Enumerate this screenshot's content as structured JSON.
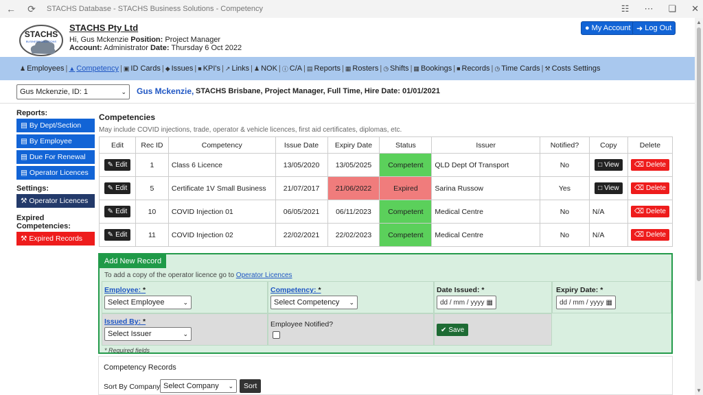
{
  "window": {
    "title": "STACHS Database - STACHS Business Solutions - Competency"
  },
  "header": {
    "logo_text": "STACHS",
    "logo_sub": "BUSINESS SOLUTIONS",
    "company": "STACHS Pty Ltd",
    "hi_prefix": "Hi, Gus Mckenzie",
    "position_label": "Position:",
    "position_value": "Project Manager",
    "account_label": "Account:",
    "account_value": "Administrator",
    "date_label": "Date:",
    "date_value": "Thursday 6 Oct 2022",
    "my_account": "My Account",
    "log_out": "Log Out"
  },
  "nav": [
    {
      "label": "Employees",
      "icon": "users-icon",
      "glyph": "♟"
    },
    {
      "label": "Competency",
      "icon": "graduation-cap-icon",
      "glyph": "▲",
      "active": true
    },
    {
      "label": "ID Cards",
      "icon": "id-card-icon",
      "glyph": "▣"
    },
    {
      "label": "Issues",
      "icon": "tag-icon",
      "glyph": "◆"
    },
    {
      "label": "KPI's",
      "icon": "briefcase-icon",
      "glyph": "■"
    },
    {
      "label": "Links",
      "icon": "external-link-icon",
      "glyph": "↗"
    },
    {
      "label": "NOK",
      "icon": "user-icon",
      "glyph": "♟"
    },
    {
      "label": "C/A",
      "icon": "info-icon",
      "glyph": "ⓘ"
    },
    {
      "label": "Reports",
      "icon": "folder-open-icon",
      "glyph": "▤"
    },
    {
      "label": "Rosters",
      "icon": "calendar-icon",
      "glyph": "▦"
    },
    {
      "label": "Shifts",
      "icon": "clock-icon",
      "glyph": "◷"
    },
    {
      "label": "Bookings",
      "icon": "calendar-check-icon",
      "glyph": "▦"
    },
    {
      "label": "Records",
      "icon": "folder-icon",
      "glyph": "■"
    },
    {
      "label": "Time Cards",
      "icon": "clock-icon",
      "glyph": "◷"
    },
    {
      "label": "Costs Settings",
      "icon": "wrench-icon",
      "glyph": "⚒"
    }
  ],
  "employee_bar": {
    "select_value": "Gus Mckenzie, ID: 1",
    "name": "Gus Mckenzie,",
    "info": "STACHS Brisbane, Project Manager, Full Time, Hire Date: 01/01/2021"
  },
  "sidebar": {
    "reports_heading": "Reports:",
    "reports": [
      "By Dept/Section",
      "By Employee",
      "Due For Renewal",
      "Operator Licences"
    ],
    "settings_heading": "Settings:",
    "settings": [
      "Operator Licences"
    ],
    "expired_heading": "Expired Competencies:",
    "expired": [
      "Expired Records"
    ]
  },
  "main": {
    "title": "Competencies",
    "subtitle": "May include COVID injections, trade, operator & vehicle licences, first aid certificates, diplomas, etc.",
    "columns": [
      "Edit",
      "Rec ID",
      "Competency",
      "Issue Date",
      "Expiry Date",
      "Status",
      "Issuer",
      "Notified?",
      "Copy",
      "Delete"
    ],
    "edit_label": "Edit",
    "view_label": "View",
    "delete_label": "Delete",
    "rows": [
      {
        "rec_id": "1",
        "competency": "Class 6 Licence",
        "issue": "13/05/2020",
        "expiry": "13/05/2025",
        "status": "Competent",
        "issuer": "QLD Dept Of Transport",
        "notified": "No",
        "copy": "View",
        "expired": false
      },
      {
        "rec_id": "5",
        "competency": "Certificate 1V Small Business",
        "issue": "21/07/2017",
        "expiry": "21/06/2022",
        "status": "Expired",
        "issuer": "Sarina Russow",
        "notified": "Yes",
        "copy": "View",
        "expired": true
      },
      {
        "rec_id": "10",
        "competency": "COVID Injection 01",
        "issue": "06/05/2021",
        "expiry": "06/11/2023",
        "status": "Competent",
        "issuer": "Medical Centre",
        "notified": "No",
        "copy": "N/A",
        "expired": false
      },
      {
        "rec_id": "11",
        "competency": "COVID Injection 02",
        "issue": "22/02/2021",
        "expiry": "22/02/2023",
        "status": "Competent",
        "issuer": "Medical Centre",
        "notified": "No",
        "copy": "N/A",
        "expired": false
      }
    ]
  },
  "add_form": {
    "tab": "Add New Record",
    "note_prefix": "To add a copy of the operator licence go to",
    "note_link": "Operator Licences",
    "employee_label": "Employee:",
    "employee_select": "Select Employee",
    "competency_label": "Competency:",
    "competency_select": "Select Competency",
    "date_issued_label": "Date Issued:",
    "expiry_label": "Expiry Date:",
    "date_placeholder": "dd / mm / yyyy",
    "issued_by_label": "Issued By:",
    "issued_by_select": "Select Issuer",
    "notified_label": "Employee Notified?",
    "save": "Save",
    "required": "* Required fields",
    "star": "*"
  },
  "records": {
    "title": "Competency Records",
    "sort_label": "Sort By Company:",
    "company_select": "Select Company",
    "sort_button": "Sort"
  },
  "colors": {
    "primary": "#1264d6",
    "nav_bg": "#a9c8ee",
    "competent": "#5bd05b",
    "expired": "#f07c7c",
    "danger": "#ee1c1c",
    "form_bg": "#d9efe0",
    "form_border": "#239a4a"
  }
}
